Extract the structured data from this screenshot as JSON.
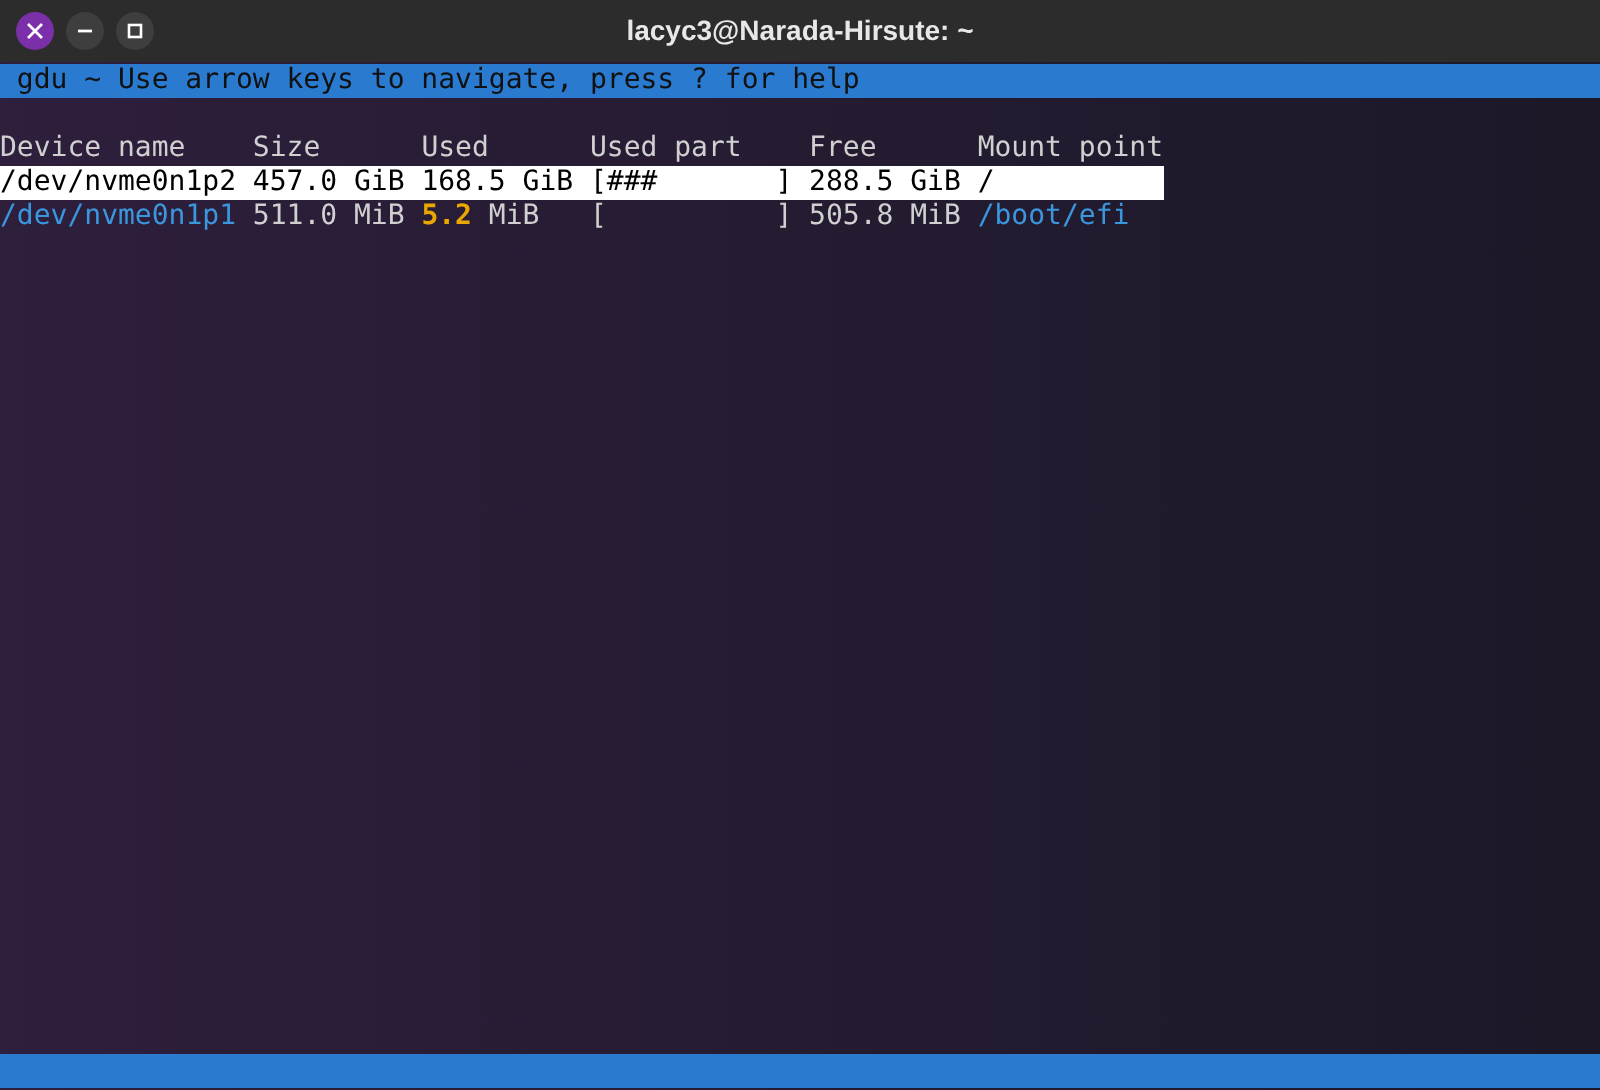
{
  "window": {
    "title": "lacyc3@Narada-Hirsute: ~"
  },
  "header_bar": {
    "text": "gdu ~ Use arrow keys to navigate, press ? for help"
  },
  "table": {
    "columns": [
      "Device name",
      "Size",
      "Used",
      "Used part",
      "Free",
      "Mount point"
    ],
    "rows": [
      {
        "device": "/dev/nvme0n1p2",
        "size": "457.0 GiB",
        "used": "168.5 GiB",
        "used_part": "[###       ]",
        "free": "288.5 GiB",
        "mount": "/",
        "selected": true,
        "used_highlight": false
      },
      {
        "device": "/dev/nvme0n1p1",
        "size": "511.0 MiB",
        "used": "5.2 MiB",
        "used_part": "[          ]",
        "free": "505.8 MiB",
        "mount": "/boot/efi",
        "selected": false,
        "used_highlight": true
      }
    ]
  }
}
